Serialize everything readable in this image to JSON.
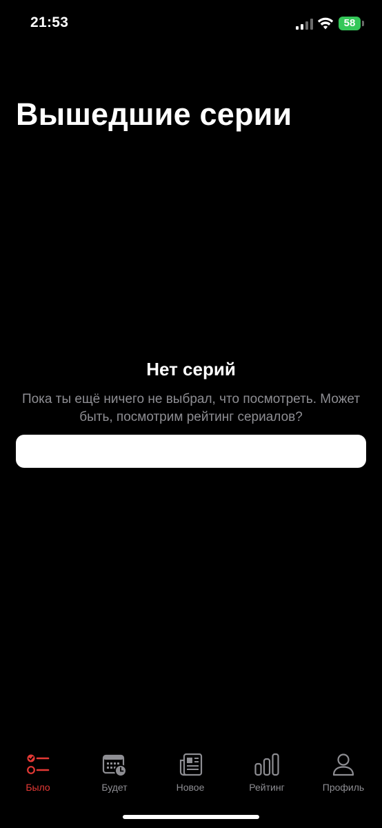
{
  "status_bar": {
    "time": "21:53",
    "battery": "58",
    "signal_icon": "cellular-signal-icon",
    "wifi_icon": "wifi-icon",
    "battery_color": "#34c759"
  },
  "page": {
    "title": "Вышедшие серии"
  },
  "empty_state": {
    "title": "Нет серий",
    "description": "Пока ты ещё ничего не выбрал, что посмотреть. Может быть, посмотрим рейтинг сериалов?",
    "button_label": ""
  },
  "tab_bar": {
    "accent_color": "#e53935",
    "inactive_color": "#8e8e93",
    "tabs": [
      {
        "label": "Было",
        "icon": "checklist-icon",
        "active": true
      },
      {
        "label": "Будет",
        "icon": "calendar-clock-icon",
        "active": false
      },
      {
        "label": "Новое",
        "icon": "newspaper-icon",
        "active": false
      },
      {
        "label": "Рейтинг",
        "icon": "bar-chart-icon",
        "active": false
      },
      {
        "label": "Профиль",
        "icon": "person-icon",
        "active": false
      }
    ]
  }
}
